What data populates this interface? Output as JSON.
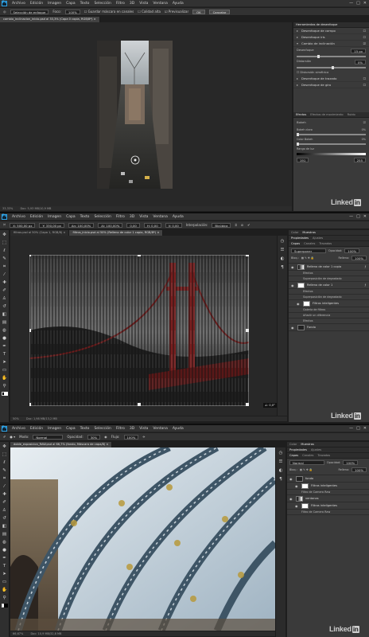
{
  "logo": "Ps",
  "menus": [
    "Archivo",
    "Edición",
    "Imagen",
    "Capa",
    "Texto",
    "Selección",
    "Filtro",
    "3D",
    "Vista",
    "Ventana",
    "Ayuda"
  ],
  "window_controls": [
    "—",
    "□",
    "✕"
  ],
  "s1": {
    "options": {
      "select_label": "Selección de enfoque",
      "focus_label": "Foco:",
      "focus_value": "100%",
      "save_mask": "Guardar máscara en canales",
      "high_quality": "Calidad alta",
      "preview": "Previsualizar",
      "ok": "OK",
      "cancel": "Cancelar"
    },
    "tab": "cambio_inclinacion_inicio.psd al 33,3% (Capa 0 copia, RGB/8*) ×",
    "status": "33,33%",
    "status_doc": "Doc: 5,93 MB/10,9 MB",
    "panel_title": "Herramientas de desenfoque",
    "effects": [
      {
        "label": "Desenfoque de campo",
        "checked": false
      },
      {
        "label": "Desenfoque iris",
        "checked": false
      },
      {
        "label": "Cambio de inclinación",
        "checked": true
      }
    ],
    "tilt": {
      "blur_label": "Desenfoque",
      "blur_value": "15 px",
      "blur_level": 0.3,
      "distortion_label": "Distorsión",
      "distortion_value": "0%",
      "distortion_level": 0.5,
      "symmetric": "Distorsión simétrica"
    },
    "effects_more": [
      {
        "label": "Desenfoque de trazado",
        "checked": false
      },
      {
        "label": "Desenfoque de giro",
        "checked": false
      }
    ],
    "fx_tabs": [
      "Efectos",
      "Efectos de movimiento",
      "Ruido"
    ],
    "bokeh": {
      "title": "Bokeh",
      "light_label": "Bokeh claro",
      "light_value": "0%",
      "color_label": "Color Bokeh",
      "color_value": "0%",
      "range_label": "Rango de luz",
      "range_min": "191",
      "range_max": "255"
    }
  },
  "s2": {
    "options": {
      "x": "X: 500,00 px",
      "y": "Y: 330,00 px",
      "w": "An: 100,00%",
      "h": "Al: 100,00%",
      "angle": "0,00",
      "hskew": "H: 0,00",
      "vskew": "V: 0,00",
      "interp_label": "Interpolación:",
      "interp_value": "Bicúbica"
    },
    "tabs": [
      "filtros.psd al 50% (Capa 1, RGB/8) ×",
      "filtros_inicio.psd al 50% (Relleno de color 1 copia, RGB/8*) ×"
    ],
    "status": "50%",
    "status_doc": "Doc: 1,98 MB/13,2 MB",
    "angle_badge": "∠: 0,0°",
    "panel_tabs": [
      "Color",
      "Muestras"
    ],
    "panel_tabs2": [
      "Propiedades",
      "Ajustes"
    ],
    "layer_tabs": [
      "Capas",
      "Canales",
      "Trazados"
    ],
    "blend_mode": "Superponer",
    "opacity_label": "Opacidad:",
    "opacity_value": "100%",
    "lock_label": "Bloq.:",
    "fill_label": "Relleno:",
    "fill_value": "100%",
    "layers": [
      {
        "label": "Relleno de color 1 copia",
        "kind": "layer",
        "thumb": "grad",
        "fx": true
      },
      {
        "label": "Efectos",
        "kind": "sub"
      },
      {
        "label": "Superposición de degradado",
        "kind": "sub"
      },
      {
        "label": "Relleno de color 1",
        "kind": "layer",
        "thumb": "white",
        "fx": true
      },
      {
        "label": "Efectos",
        "kind": "sub"
      },
      {
        "label": "Superposición de degradado",
        "kind": "sub"
      },
      {
        "label": "Filtros inteligentes",
        "kind": "smart",
        "thumb": "white"
      },
      {
        "label": "Galería de filtros",
        "kind": "sub"
      },
      {
        "label": "Añadir un diferencia",
        "kind": "sub"
      },
      {
        "label": "Efectos",
        "kind": "sub"
      },
      {
        "label": "Fondo",
        "kind": "layer",
        "thumb": "dark",
        "fx": false
      }
    ]
  },
  "s3": {
    "options": {
      "mode_label": "Modo:",
      "mode_value": "Normal",
      "opacity_label": "Opacidad:",
      "opacity_value": "30%",
      "flow_label": "Flujo:",
      "flow_value": "100%"
    },
    "tab": "doble_exposicion_RAW.psd al 66,7% (fondo, Máscara de capa/8) ×",
    "status": "66,67%",
    "status_doc": "Doc: 10,9 MB/32,8 MB",
    "panel_tabs": [
      "Color",
      "Muestras"
    ],
    "panel_tabs2": [
      "Propiedades",
      "Ajustes"
    ],
    "layer_tabs": [
      "Capas",
      "Canales",
      "Trazados"
    ],
    "blend_mode": "Normal",
    "opacity_label": "Opacidad:",
    "opacity_value": "100%",
    "lock_label": "Bloq.:",
    "fill_label": "Relleno:",
    "fill_value": "100%",
    "layers": [
      {
        "label": "fondo",
        "kind": "layer",
        "thumb": "dark",
        "fx": false
      },
      {
        "label": "Filtros inteligentes",
        "kind": "smart",
        "thumb": "white"
      },
      {
        "label": "Filtro de Camera Raw",
        "kind": "sub"
      },
      {
        "label": "ventanas",
        "kind": "layer",
        "thumb": "grad",
        "fx": false
      },
      {
        "label": "Filtros inteligentes",
        "kind": "smart",
        "thumb": "white"
      },
      {
        "label": "Filtro de Camera Raw",
        "kind": "sub"
      }
    ]
  },
  "watermark": {
    "text": "Linked",
    "badge": "in"
  },
  "colors": {
    "accent": "#2fa3e6",
    "panel": "#3a3a3a",
    "chrome": "#323232",
    "canvas": "#282828"
  }
}
